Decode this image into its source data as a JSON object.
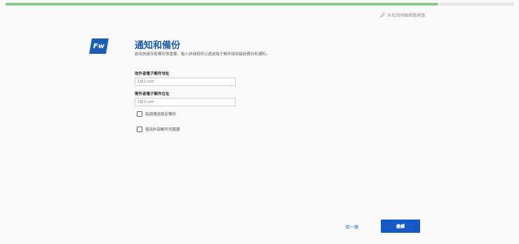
{
  "progress": {
    "value": 0.85,
    "color": "#8cc68a"
  },
  "report_link": {
    "label": "未找到明顯網路建議",
    "icon": "pencil-icon"
  },
  "logo": {
    "text": "Fw",
    "color": "#1a5fb4"
  },
  "header": {
    "title": "通知和備份",
    "description": "啟用快速存取備份很重要。輸入詳細資訊以透過電子郵件接收最新備份和通知。"
  },
  "form": {
    "recipient": {
      "label": "收件者電子郵件地址",
      "placeholder": "1@1.com"
    },
    "sender": {
      "label": "寄件者電子郵件位址",
      "placeholder": "1@1.com"
    },
    "daily_backup": {
      "label": "每週傳送設定備份",
      "checked": false
    },
    "external_mail": {
      "label": "使用外部郵件伺服器",
      "checked": false
    }
  },
  "footer": {
    "prev_label": "前一個",
    "continue_label": "繼續"
  }
}
